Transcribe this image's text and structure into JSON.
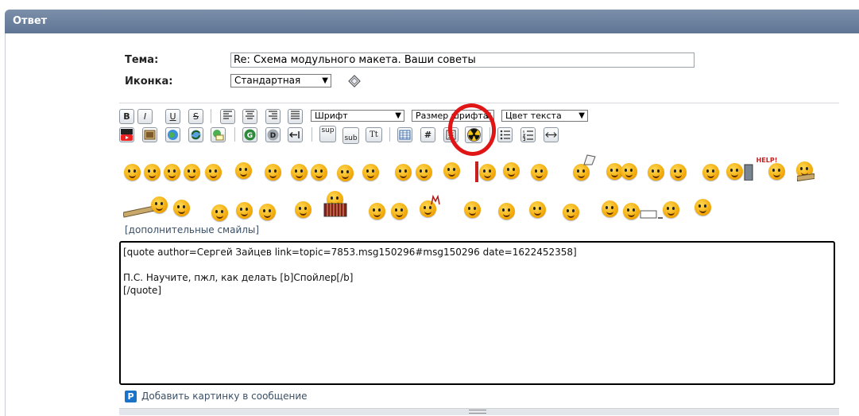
{
  "window": {
    "title": "Ответ"
  },
  "form": {
    "subject_label": "Тема:",
    "subject_value": "Re: Схема модульного макета. Ваши советы",
    "icon_label": "Иконка:",
    "icon_value": "Стандартная"
  },
  "toolbar": {
    "bold": "B",
    "italic": "I",
    "underline": "U",
    "strike": "S",
    "font_select": "Шрифт",
    "size_select": "Размер шрифта",
    "color_select": "Цвет текста",
    "sup": "sup",
    "sub": "sub",
    "tt": "Tt",
    "hash": "#"
  },
  "smileys": {
    "count_row1": 32,
    "count_row2": 24,
    "more_link": "[дополнительные смайлы]"
  },
  "editor": {
    "content": "[quote author=Сергей Зайцев link=topic=7853.msg150296#msg150296 date=1622452358]\n\nП.С. Научите, пжл, как делать [b]Спойлер[/b]\n[/quote]"
  },
  "footer": {
    "add_image": "Добавить картинку в сообщение"
  },
  "colors": {
    "titlebar": "#6a7f9c",
    "annotation": "#e01515",
    "link": "#3a4f66"
  }
}
